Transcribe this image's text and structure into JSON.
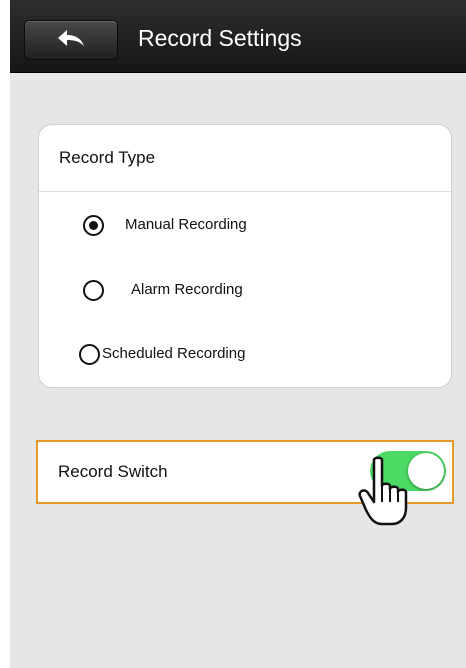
{
  "header": {
    "title": "Record Settings",
    "back_icon": "back-arrow-icon"
  },
  "record_type": {
    "label": "Record Type",
    "selected": "manual",
    "options": [
      {
        "id": "manual",
        "label": "Manual Recording",
        "checked": true
      },
      {
        "id": "alarm",
        "label": "Alarm Recording",
        "checked": false
      },
      {
        "id": "scheduled",
        "label": "Scheduled Recording",
        "checked": false
      }
    ]
  },
  "record_switch": {
    "label": "Record Switch",
    "on": true,
    "on_color": "#4cd964",
    "highlight_color": "#e39a2c"
  },
  "overlay": {
    "cursor_icon": "hand-pointer-icon"
  }
}
